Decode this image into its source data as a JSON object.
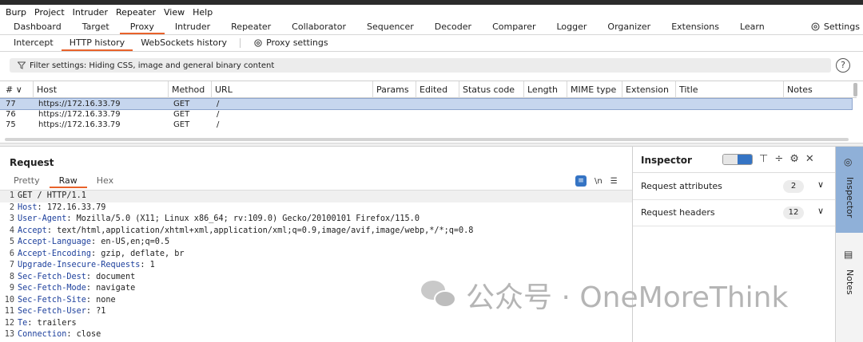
{
  "menu": [
    "Burp",
    "Project",
    "Intruder",
    "Repeater",
    "View",
    "Help"
  ],
  "top_tabs": [
    "Dashboard",
    "Target",
    "Proxy",
    "Intruder",
    "Repeater",
    "Collaborator",
    "Sequencer",
    "Decoder",
    "Comparer",
    "Logger",
    "Organizer",
    "Extensions",
    "Learn"
  ],
  "top_tabs_active": "Proxy",
  "settings_label": "Settings",
  "sub_tabs": [
    "Intercept",
    "HTTP history",
    "WebSockets history"
  ],
  "sub_tabs_active": "HTTP history",
  "proxy_settings_label": "Proxy settings",
  "filter": {
    "text": "Filter settings: Hiding CSS, image and general binary content",
    "help": "?"
  },
  "history": {
    "columns": [
      "# ∨",
      "Host",
      "Method",
      "URL",
      "Params",
      "Edited",
      "Status code",
      "Length",
      "MIME type",
      "Extension",
      "Title",
      "Notes"
    ],
    "rows": [
      {
        "num": "77",
        "host": "https://172.16.33.79",
        "method": "GET",
        "url": "/",
        "selected": true
      },
      {
        "num": "76",
        "host": "https://172.16.33.79",
        "method": "GET",
        "url": "/",
        "selected": false
      },
      {
        "num": "75",
        "host": "https://172.16.33.79",
        "method": "GET",
        "url": "/",
        "selected": false
      }
    ]
  },
  "request": {
    "title": "Request",
    "tabs": [
      "Pretty",
      "Raw",
      "Hex"
    ],
    "active_tab": "Raw",
    "tool_newline": "\\n",
    "lines": [
      {
        "n": "1",
        "key": "",
        "val": "GET / HTTP/1.1"
      },
      {
        "n": "2",
        "key": "Host",
        "val": ": 172.16.33.79"
      },
      {
        "n": "3",
        "key": "User-Agent",
        "val": ": Mozilla/5.0 (X11; Linux x86_64; rv:109.0) Gecko/20100101 Firefox/115.0"
      },
      {
        "n": "4",
        "key": "Accept",
        "val": ": text/html,application/xhtml+xml,application/xml;q=0.9,image/avif,image/webp,*/*;q=0.8"
      },
      {
        "n": "5",
        "key": "Accept-Language",
        "val": ": en-US,en;q=0.5"
      },
      {
        "n": "6",
        "key": "Accept-Encoding",
        "val": ": gzip, deflate, br"
      },
      {
        "n": "7",
        "key": "Upgrade-Insecure-Requests",
        "val": ": 1"
      },
      {
        "n": "8",
        "key": "Sec-Fetch-Dest",
        "val": ": document"
      },
      {
        "n": "9",
        "key": "Sec-Fetch-Mode",
        "val": ": navigate"
      },
      {
        "n": "10",
        "key": "Sec-Fetch-Site",
        "val": ": none"
      },
      {
        "n": "11",
        "key": "Sec-Fetch-User",
        "val": ": ?1"
      },
      {
        "n": "12",
        "key": "Te",
        "val": ": trailers"
      },
      {
        "n": "13",
        "key": "Connection",
        "val": ": close"
      }
    ]
  },
  "inspector": {
    "title": "Inspector",
    "sections": [
      {
        "label": "Request attributes",
        "count": "2"
      },
      {
        "label": "Request headers",
        "count": "12"
      }
    ]
  },
  "sidebar": {
    "inspector_label": "Inspector",
    "notes_label": "Notes"
  },
  "watermark": {
    "text": "公众号 · OneMoreThink"
  },
  "colors": {
    "accent_orange": "#e8622a",
    "selected_row": "#c6d6ee",
    "header_key_blue": "#1c3f9c",
    "inspector_tab_blue": "#8fb0d8"
  }
}
